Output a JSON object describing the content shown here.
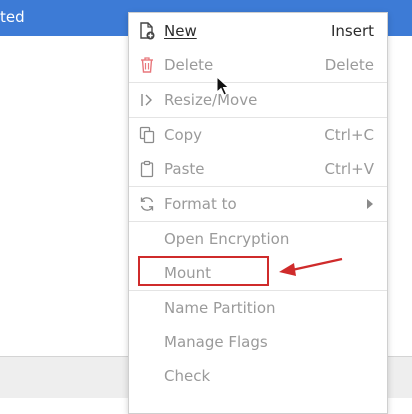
{
  "window": {
    "title_fragment": "ted"
  },
  "menu": {
    "items": [
      {
        "label": "New",
        "shortcut": "Insert",
        "icon": "new-partition-icon",
        "enabled": true
      },
      {
        "label": "Delete",
        "shortcut": "Delete",
        "icon": "trash-icon",
        "enabled": false
      },
      {
        "label": "Resize/Move",
        "shortcut": "",
        "icon": "resize-icon",
        "enabled": false
      },
      {
        "label": "Copy",
        "shortcut": "Ctrl+C",
        "icon": "copy-icon",
        "enabled": false
      },
      {
        "label": "Paste",
        "shortcut": "Ctrl+V",
        "icon": "paste-icon",
        "enabled": false
      },
      {
        "label": "Format to",
        "shortcut": "",
        "icon": "format-icon",
        "enabled": false,
        "submenu": true
      },
      {
        "label": "Open Encryption",
        "shortcut": "",
        "icon": "",
        "enabled": false
      },
      {
        "label": "Mount",
        "shortcut": "",
        "icon": "",
        "enabled": false,
        "annotated": true
      },
      {
        "label": "Name Partition",
        "shortcut": "",
        "icon": "",
        "enabled": false
      },
      {
        "label": "Manage Flags",
        "shortcut": "",
        "icon": "",
        "enabled": false
      },
      {
        "label": "Check",
        "shortcut": "",
        "icon": "",
        "enabled": false
      }
    ]
  },
  "annotation": {
    "color": "#cf2b2b",
    "target": "Mount"
  },
  "colors": {
    "title_bar": "#3d7bd6",
    "enabled_text": "#2b2b2b",
    "disabled_text": "#9a9a9a",
    "delete_icon": "#e8777c"
  }
}
